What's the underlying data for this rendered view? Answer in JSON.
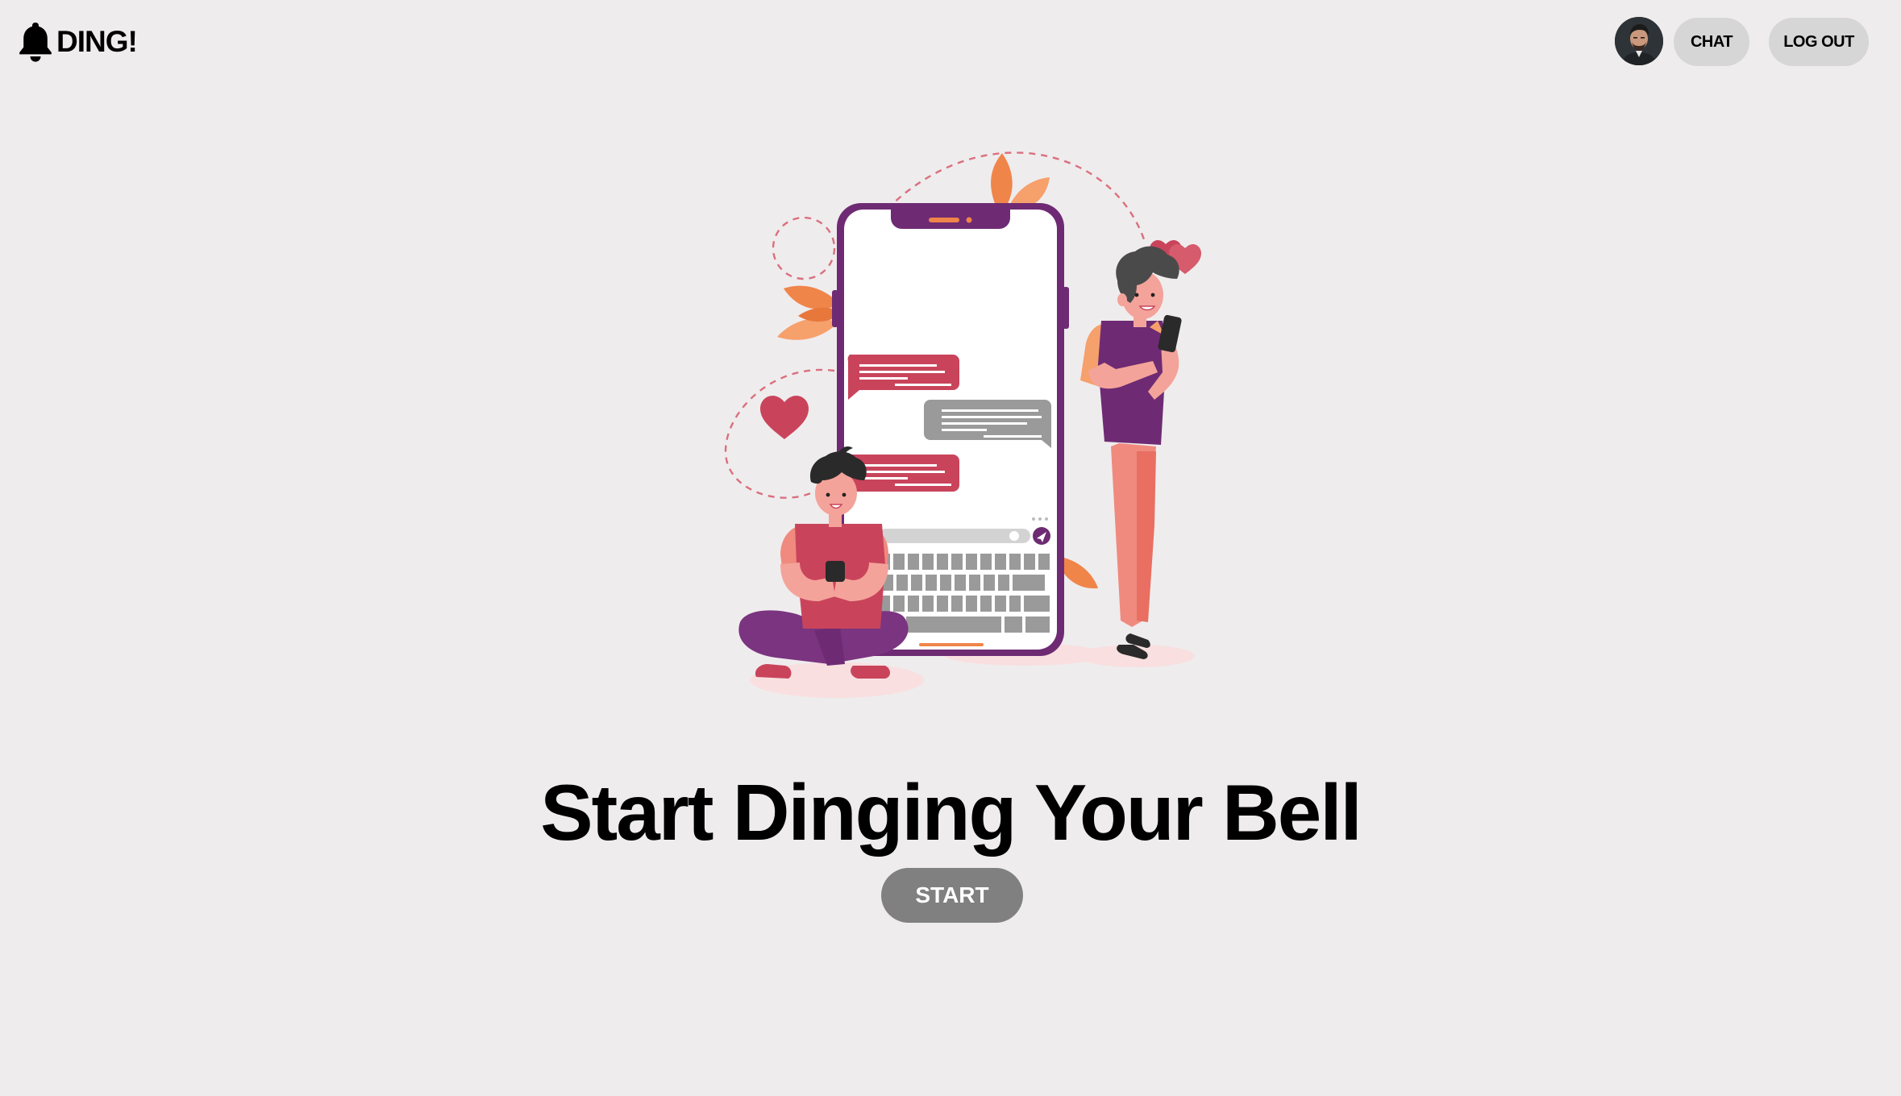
{
  "brand": {
    "name": "DING!",
    "icon": "bell-icon"
  },
  "nav": {
    "avatar_icon": "user-avatar",
    "chat_label": "CHAT",
    "logout_label": "LOG OUT"
  },
  "hero": {
    "title": "Start Dinging Your Bell",
    "start_label": "START"
  },
  "colors": {
    "background": "#efeced",
    "button_gray": "#808080",
    "pill_gray": "#d6d6d6",
    "accent_purple": "#6e2b73",
    "accent_red": "#c9445b",
    "accent_orange": "#f0854a"
  }
}
